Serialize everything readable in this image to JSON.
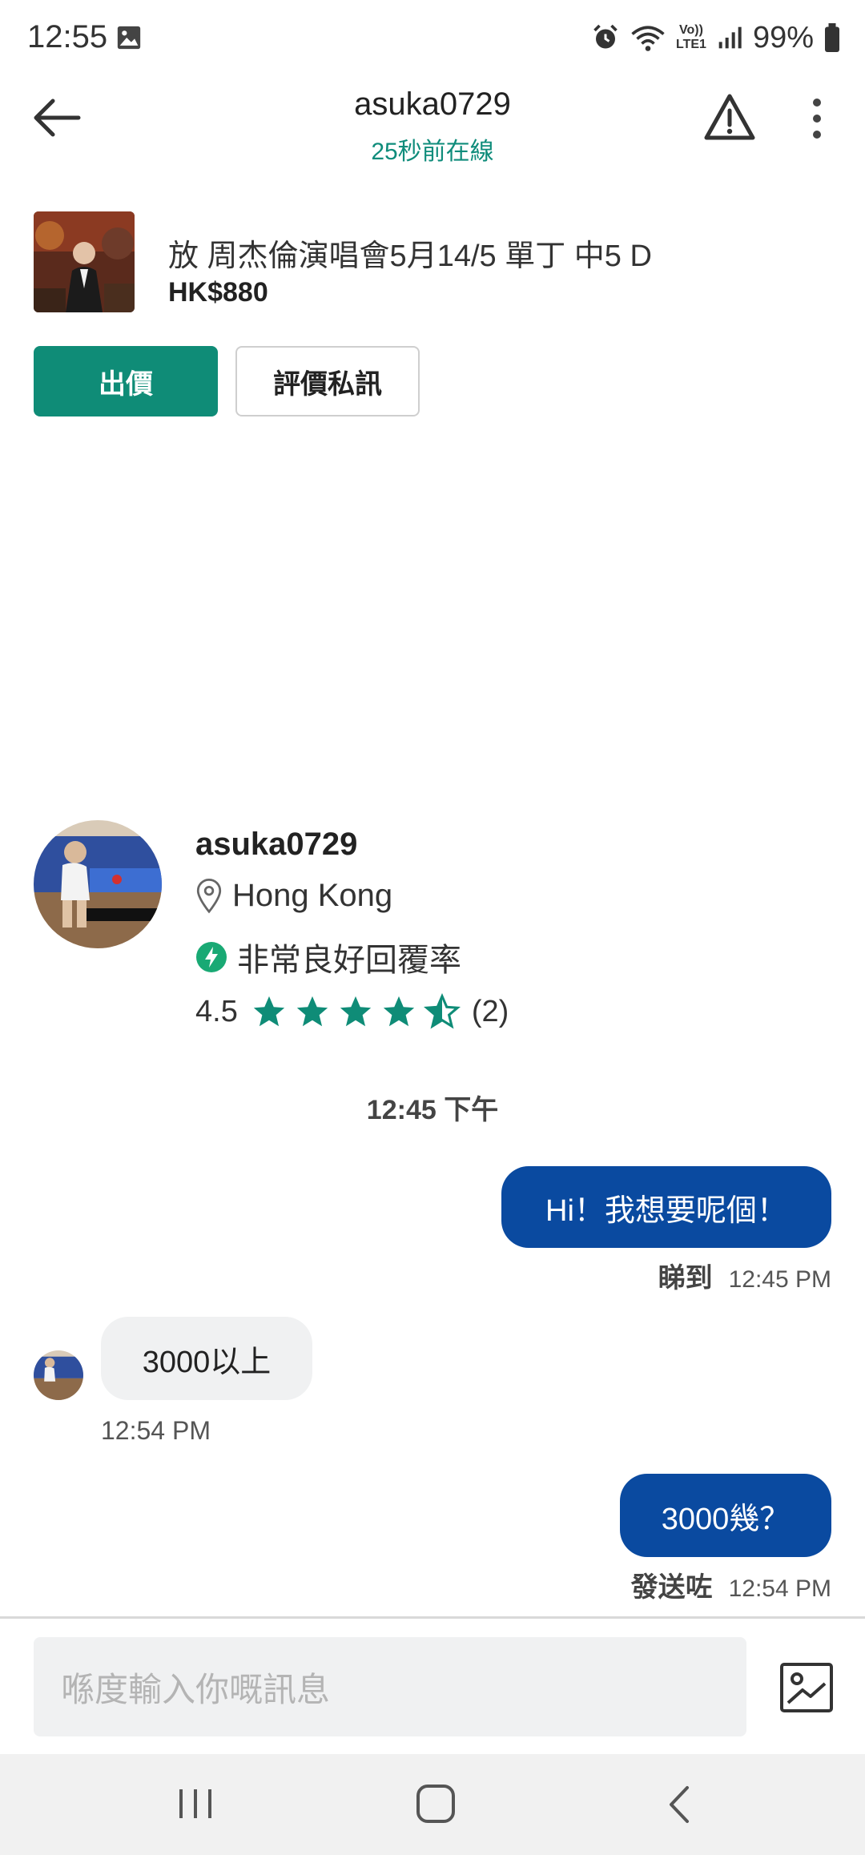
{
  "status_bar": {
    "time": "12:55",
    "battery": "99%",
    "volte": "Vo))",
    "lte": "LTE1"
  },
  "header": {
    "username": "asuka0729",
    "online_status": "25秒前在線"
  },
  "listing": {
    "title": "放 周杰倫演唱會5月14/5 單丁 中5 D",
    "price": "HK$880",
    "offer_button": "出價",
    "review_button": "評價私訊"
  },
  "seller": {
    "name": "asuka0729",
    "location": "Hong Kong",
    "response": "非常良好回覆率",
    "rating": "4.5",
    "rating_value": 4.5,
    "review_count": "(2)"
  },
  "chat": {
    "date_separator": "12:45 下午",
    "messages": [
      {
        "text": "Hi！我想要呢個！",
        "status": "睇到",
        "time": "12:45 PM",
        "direction": "outgoing"
      },
      {
        "text": "3000以上",
        "time": "12:54 PM",
        "direction": "incoming"
      },
      {
        "text": "3000幾？",
        "status": "發送咗",
        "time": "12:54 PM",
        "direction": "outgoing"
      }
    ]
  },
  "composer": {
    "placeholder": "喺度輸入你嘅訊息"
  },
  "colors": {
    "accent_green": "#0f8c77",
    "outgoing_bubble": "#0a4aa0",
    "incoming_bubble": "#f0f1f2"
  }
}
